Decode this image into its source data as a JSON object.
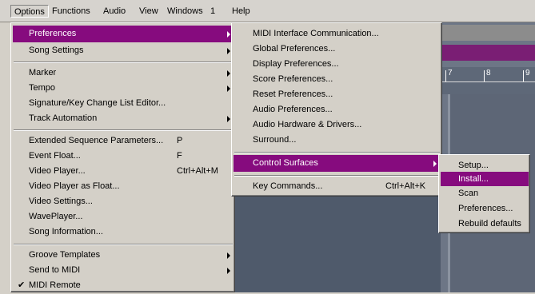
{
  "menubar": {
    "items": [
      {
        "label": "Options"
      },
      {
        "label": "Functions"
      },
      {
        "label": "Audio"
      },
      {
        "label": "View"
      },
      {
        "label": "Windows"
      },
      {
        "label": "1"
      },
      {
        "label": "Help"
      }
    ]
  },
  "ruler": {
    "marks": [
      "7",
      "8",
      "9"
    ]
  },
  "options_menu": {
    "items": [
      {
        "label": "Preferences",
        "shortcut": ""
      },
      {
        "label": "Song Settings",
        "shortcut": ""
      },
      {
        "label": "Marker",
        "shortcut": ""
      },
      {
        "label": "Tempo",
        "shortcut": ""
      },
      {
        "label": "Signature/Key Change List Editor...",
        "shortcut": ""
      },
      {
        "label": "Track Automation",
        "shortcut": ""
      },
      {
        "label": "Extended Sequence Parameters...",
        "shortcut": "P"
      },
      {
        "label": "Event Float...",
        "shortcut": "F"
      },
      {
        "label": "Video Player...",
        "shortcut": "Ctrl+Alt+M"
      },
      {
        "label": "Video Player as Float...",
        "shortcut": ""
      },
      {
        "label": "Video Settings...",
        "shortcut": ""
      },
      {
        "label": "WavePlayer...",
        "shortcut": ""
      },
      {
        "label": "Song Information...",
        "shortcut": ""
      },
      {
        "label": "Groove Templates",
        "shortcut": ""
      },
      {
        "label": "Send to MIDI",
        "shortcut": ""
      },
      {
        "label": "MIDI Remote",
        "shortcut": "",
        "check": "✔"
      }
    ]
  },
  "preferences_menu": {
    "items": [
      {
        "label": "MIDI Interface Communication...",
        "shortcut": ""
      },
      {
        "label": "Global Preferences...",
        "shortcut": ""
      },
      {
        "label": "Display Preferences...",
        "shortcut": ""
      },
      {
        "label": "Score Preferences...",
        "shortcut": ""
      },
      {
        "label": "Reset Preferences...",
        "shortcut": ""
      },
      {
        "label": "Audio Preferences...",
        "shortcut": ""
      },
      {
        "label": "Audio Hardware & Drivers...",
        "shortcut": ""
      },
      {
        "label": "Surround...",
        "shortcut": ""
      },
      {
        "label": "Control Surfaces",
        "shortcut": ""
      },
      {
        "label": "Key Commands...",
        "shortcut": "Ctrl+Alt+K"
      }
    ]
  },
  "control_surfaces_menu": {
    "items": [
      {
        "label": "Setup..."
      },
      {
        "label": "Install..."
      },
      {
        "label": "Scan"
      },
      {
        "label": "Preferences..."
      },
      {
        "label": "Rebuild defaults"
      }
    ]
  },
  "colors": {
    "highlight": "#860b7e",
    "menu_bg": "#d4d0c8",
    "app_bg": "#6d7686"
  }
}
